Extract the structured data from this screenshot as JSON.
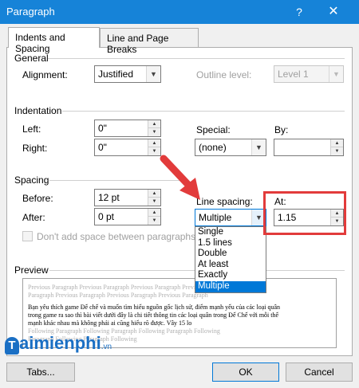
{
  "window": {
    "title": "Paragraph",
    "help": "?",
    "close": "✕"
  },
  "tabs": [
    {
      "label": "Indents and Spacing",
      "active": true
    },
    {
      "label": "Line and Page Breaks",
      "active": false
    }
  ],
  "general": {
    "header": "General",
    "alignment_label": "Alignment:",
    "alignment_value": "Justified",
    "outline_label": "Outline level:",
    "outline_value": "Level 1"
  },
  "indentation": {
    "header": "Indentation",
    "left_label": "Left:",
    "left_value": "0\"",
    "right_label": "Right:",
    "right_value": "0\"",
    "special_label": "Special:",
    "special_value": "(none)",
    "by_label": "By:",
    "by_value": ""
  },
  "spacing": {
    "header": "Spacing",
    "before_label": "Before:",
    "before_value": "12 pt",
    "after_label": "After:",
    "after_value": "0 pt",
    "line_spacing_label": "Line spacing:",
    "line_spacing_value": "Multiple",
    "at_label": "At:",
    "at_value": "1.15",
    "dont_add_label": "Don't add space between paragraphs of s"
  },
  "line_spacing_options": [
    "Single",
    "1.5 lines",
    "Double",
    "At least",
    "Exactly",
    "Multiple"
  ],
  "preview": {
    "header": "Preview",
    "prev1": "Previous Paragraph Previous Paragraph Previous Paragraph Previous Paragraph",
    "prev2": "Paragraph Previous Paragraph Previous Paragraph Previous Paragraph",
    "body1": "Bạn yêu thích game Đế chế và muốn tìm hiểu nguồn gốc lịch sử, điểm mạnh yếu của các loại quân",
    "body2": "trong game ra sao thì bài viết dưới đây là chi tiết thông tin các loại quân trong Đế Chế với mỗi thế",
    "body3": "mạnh khác nhau mà không phải ai cũng hiểu rõ được. Vây 15 lo",
    "follow1": "Following Paragraph Following Paragraph Following Paragraph Following",
    "follow2": "Paragraph Following Paragraph Following"
  },
  "buttons": {
    "tabs": "Tabs...",
    "ok": "OK",
    "cancel": "Cancel"
  },
  "watermark": {
    "text": "aimienphi",
    "suffix": ".vn"
  }
}
